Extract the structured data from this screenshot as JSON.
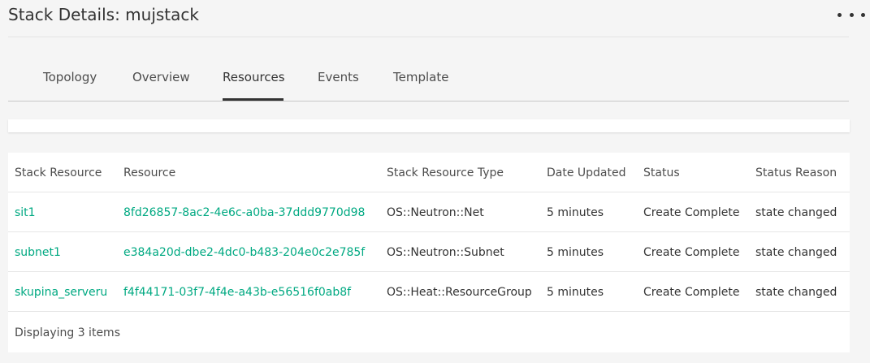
{
  "header": {
    "title": "Stack Details: mujstack",
    "more_icon": "more-horizontal-icon"
  },
  "tabs": [
    {
      "label": "Topology",
      "active": false
    },
    {
      "label": "Overview",
      "active": false
    },
    {
      "label": "Resources",
      "active": true
    },
    {
      "label": "Events",
      "active": false
    },
    {
      "label": "Template",
      "active": false
    }
  ],
  "table": {
    "columns": [
      "Stack Resource",
      "Resource",
      "Stack Resource Type",
      "Date Updated",
      "Status",
      "Status Reason"
    ],
    "rows": [
      {
        "stack_resource": "sit1",
        "resource": "8fd26857-8ac2-4e6c-a0ba-37ddd9770d98",
        "type": "OS::Neutron::Net",
        "date_updated": "5 minutes",
        "status": "Create Complete",
        "status_reason": "state changed"
      },
      {
        "stack_resource": "subnet1",
        "resource": "e384a20d-dbe2-4dc0-b483-204e0c2e785f",
        "type": "OS::Neutron::Subnet",
        "date_updated": "5 minutes",
        "status": "Create Complete",
        "status_reason": "state changed"
      },
      {
        "stack_resource": "skupina_serveru",
        "resource": "f4f44171-03f7-4f4e-a43b-e56516f0ab8f",
        "type": "OS::Heat::ResourceGroup",
        "date_updated": "5 minutes",
        "status": "Create Complete",
        "status_reason": "state changed"
      }
    ],
    "footer": "Displaying 3 items"
  },
  "colors": {
    "link": "#01a982",
    "background": "#f5f5f5",
    "panel": "#ffffff",
    "text": "#333333"
  }
}
